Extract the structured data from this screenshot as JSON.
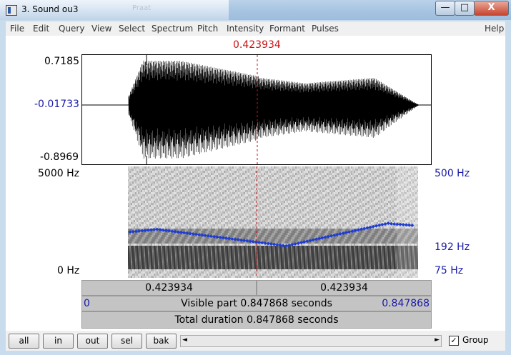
{
  "window": {
    "title": "3. Sound ou3",
    "ghost_title": "Praat",
    "minimize": "—",
    "maximize": "□",
    "close": "X"
  },
  "menu": [
    "File",
    "Edit",
    "Query",
    "View",
    "Select",
    "Spectrum",
    "Pitch",
    "Intensity",
    "Formant",
    "Pulses"
  ],
  "help": "Help",
  "cursor": {
    "time": "0.423934",
    "fraction": 0.5
  },
  "waveform": {
    "max": "0.7185",
    "zero": "-0.01733",
    "min": "-0.8969"
  },
  "spectrogram": {
    "max": "5000 Hz",
    "min": "0 Hz"
  },
  "pitch_axis": {
    "top": "500 Hz",
    "mid": "192 Hz",
    "bottom": "75 Hz"
  },
  "bars": {
    "left_time": "0.423934",
    "right_time": "0.423934",
    "visible_start": "0",
    "visible_text": "Visible part 0.847868 seconds",
    "visible_end": "0.847868",
    "total_text": "Total duration 0.847868 seconds"
  },
  "buttons": {
    "all": "all",
    "in": "in",
    "out": "out",
    "sel": "sel",
    "bak": "bak"
  },
  "scroll": {
    "left": "◄",
    "right": "►"
  },
  "group": {
    "label": "Group",
    "checked": "✓"
  },
  "colors": {
    "pitch": "#1e3cd2",
    "cursor": "#c81414",
    "axis_blue": "#1a1aa8"
  }
}
